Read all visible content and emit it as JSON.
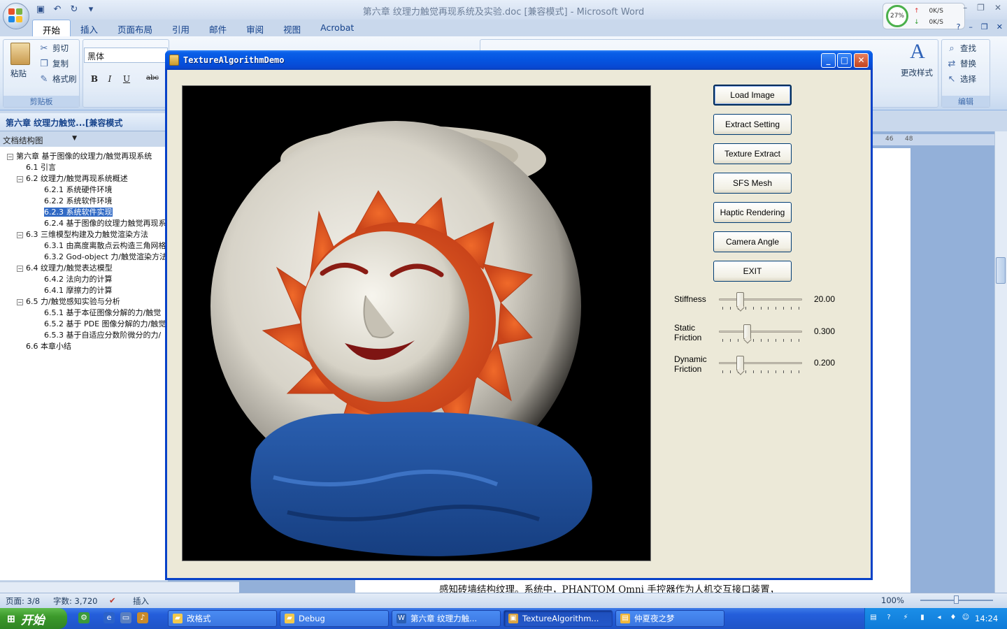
{
  "word": {
    "title": "第六章 纹理力触觉再现系统及实验.doc [兼容模式] - Microsoft Word",
    "ribbon_tabs": [
      "开始",
      "插入",
      "页面布局",
      "引用",
      "邮件",
      "审阅",
      "视图",
      "Acrobat"
    ],
    "clipboard": {
      "paste": "粘贴",
      "cut": "剪切",
      "copy": "复制",
      "format_painter": "格式刷",
      "group": "剪贴板"
    },
    "font": {
      "name": "黑体"
    },
    "editing": {
      "find": "查找",
      "replace": "替换",
      "select": "选择",
      "group": "编辑",
      "change_styles": "更改样式"
    },
    "network": {
      "percent": "27%",
      "up": "0K/S",
      "down": "0K/S"
    },
    "doc_tab": "第六章 纹理力触觉...[兼容模式",
    "nav_mode": "文档结构图",
    "ruler": [
      "46",
      "48"
    ],
    "nav_tree": [
      {
        "label": "第六章 基于图像的纹理力/触觉再现系统",
        "level": 0,
        "toggle": "−"
      },
      {
        "label": "6.1 引言",
        "level": 1
      },
      {
        "label": "6.2 纹理力/触觉再现系统概述",
        "level": 1,
        "toggle": "−"
      },
      {
        "label": "6.2.1 系统硬件环境",
        "level": 2
      },
      {
        "label": "6.2.2 系统软件环境",
        "level": 2
      },
      {
        "label": "6.2.3 系统软件实现",
        "level": 2,
        "selected": true
      },
      {
        "label": "6.2.4 基于图像的纹理力触觉再现系",
        "level": 2
      },
      {
        "label": "6.3 三维模型构建及力触觉渲染方法",
        "level": 1,
        "toggle": "−"
      },
      {
        "label": "6.3.1 由高度离散点云构造三角网格",
        "level": 2
      },
      {
        "label": "6.3.2 God-object 力/触觉渲染方法",
        "level": 2
      },
      {
        "label": "6.4 纹理力/触觉表达模型",
        "level": 1,
        "toggle": "−"
      },
      {
        "label": "6.4.2 法向力的计算",
        "level": 2
      },
      {
        "label": "6.4.1 摩擦力的计算",
        "level": 2
      },
      {
        "label": "6.5 力/触觉感知实验与分析",
        "level": 1,
        "toggle": "−"
      },
      {
        "label": "6.5.1 基于本征图像分解的力/触觉",
        "level": 2
      },
      {
        "label": "6.5.2 基于 PDE 图像分解的力/触觉",
        "level": 2
      },
      {
        "label": "6.5.3 基于自适应分数阶微分的力/",
        "level": 2
      },
      {
        "label": "6.6 本章小结",
        "level": 1
      }
    ],
    "doc_text": "感知砖墙结构纹理。系统中，PHANTOM Omni 手控器作为人机交互接口装置，",
    "status": {
      "page": "页面: 3/8",
      "words": "字数: 3,720",
      "mode": "插入",
      "zoom": "100%"
    }
  },
  "demo": {
    "title": "TextureAlgorithmDemo",
    "buttons": [
      "Load Image",
      "Extract Setting",
      "Texture Extract",
      "SFS Mesh",
      "Haptic Rendering",
      "Camera Angle",
      "EXIT"
    ],
    "sliders": [
      {
        "label": "Stiffness",
        "value": "20.00",
        "position": 0.23
      },
      {
        "label": "Static Friction",
        "value": "0.300",
        "position": 0.32
      },
      {
        "label": "Dynamic Friction",
        "value": "0.200",
        "position": 0.23
      }
    ]
  },
  "taskbar": {
    "start": "开始",
    "tasks": [
      {
        "label": "改格式",
        "icon": "folder-icon"
      },
      {
        "label": "Debug",
        "icon": "folder-icon"
      },
      {
        "label": "第六章 纹理力触...",
        "icon": "word-doc-icon"
      },
      {
        "label": "TextureAlgorithm...",
        "icon": "app-icon",
        "active": true
      },
      {
        "label": "仲夏夜之梦",
        "icon": "notes-icon"
      }
    ],
    "clock": "14:24"
  },
  "colors": {
    "xp_title_blue": "#0554e0",
    "dialog_face": "#ece9d8",
    "word_ribbon": "#dbe7f6",
    "image_background": "#000000",
    "sun_orange": "#e2551c",
    "base_blue": "#1f4f9e"
  }
}
